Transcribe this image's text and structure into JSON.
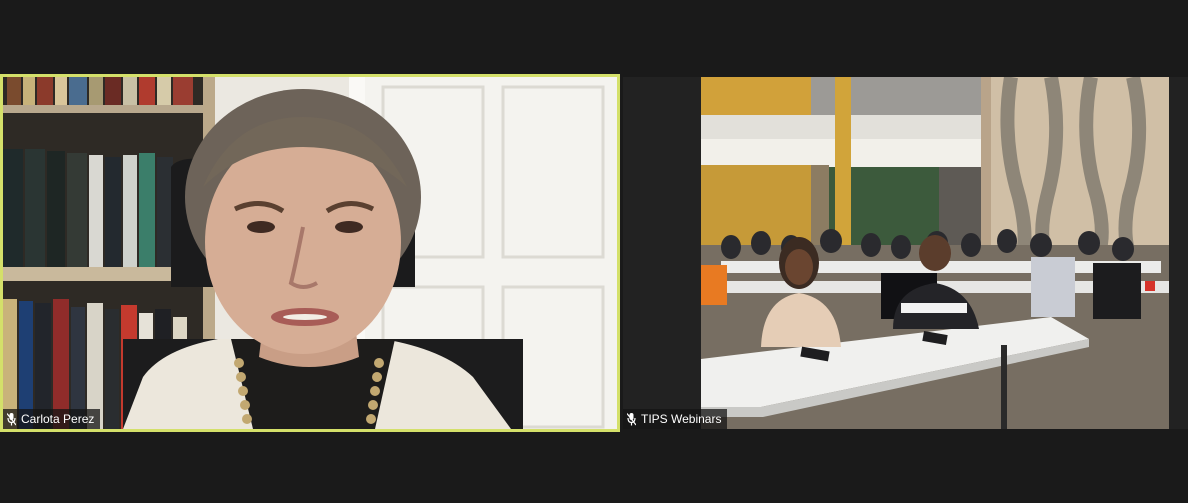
{
  "participants": [
    {
      "name": "Carlota Perez",
      "active_speaker": true,
      "mic_icon": "mic-muted-icon"
    },
    {
      "name": "TIPS Webinars",
      "active_speaker": false,
      "mic_icon": "mic-muted-icon"
    }
  ],
  "colors": {
    "background": "#1a1a1a",
    "active_speaker_border": "#d4e06a",
    "name_tag_bg": "#141414"
  }
}
